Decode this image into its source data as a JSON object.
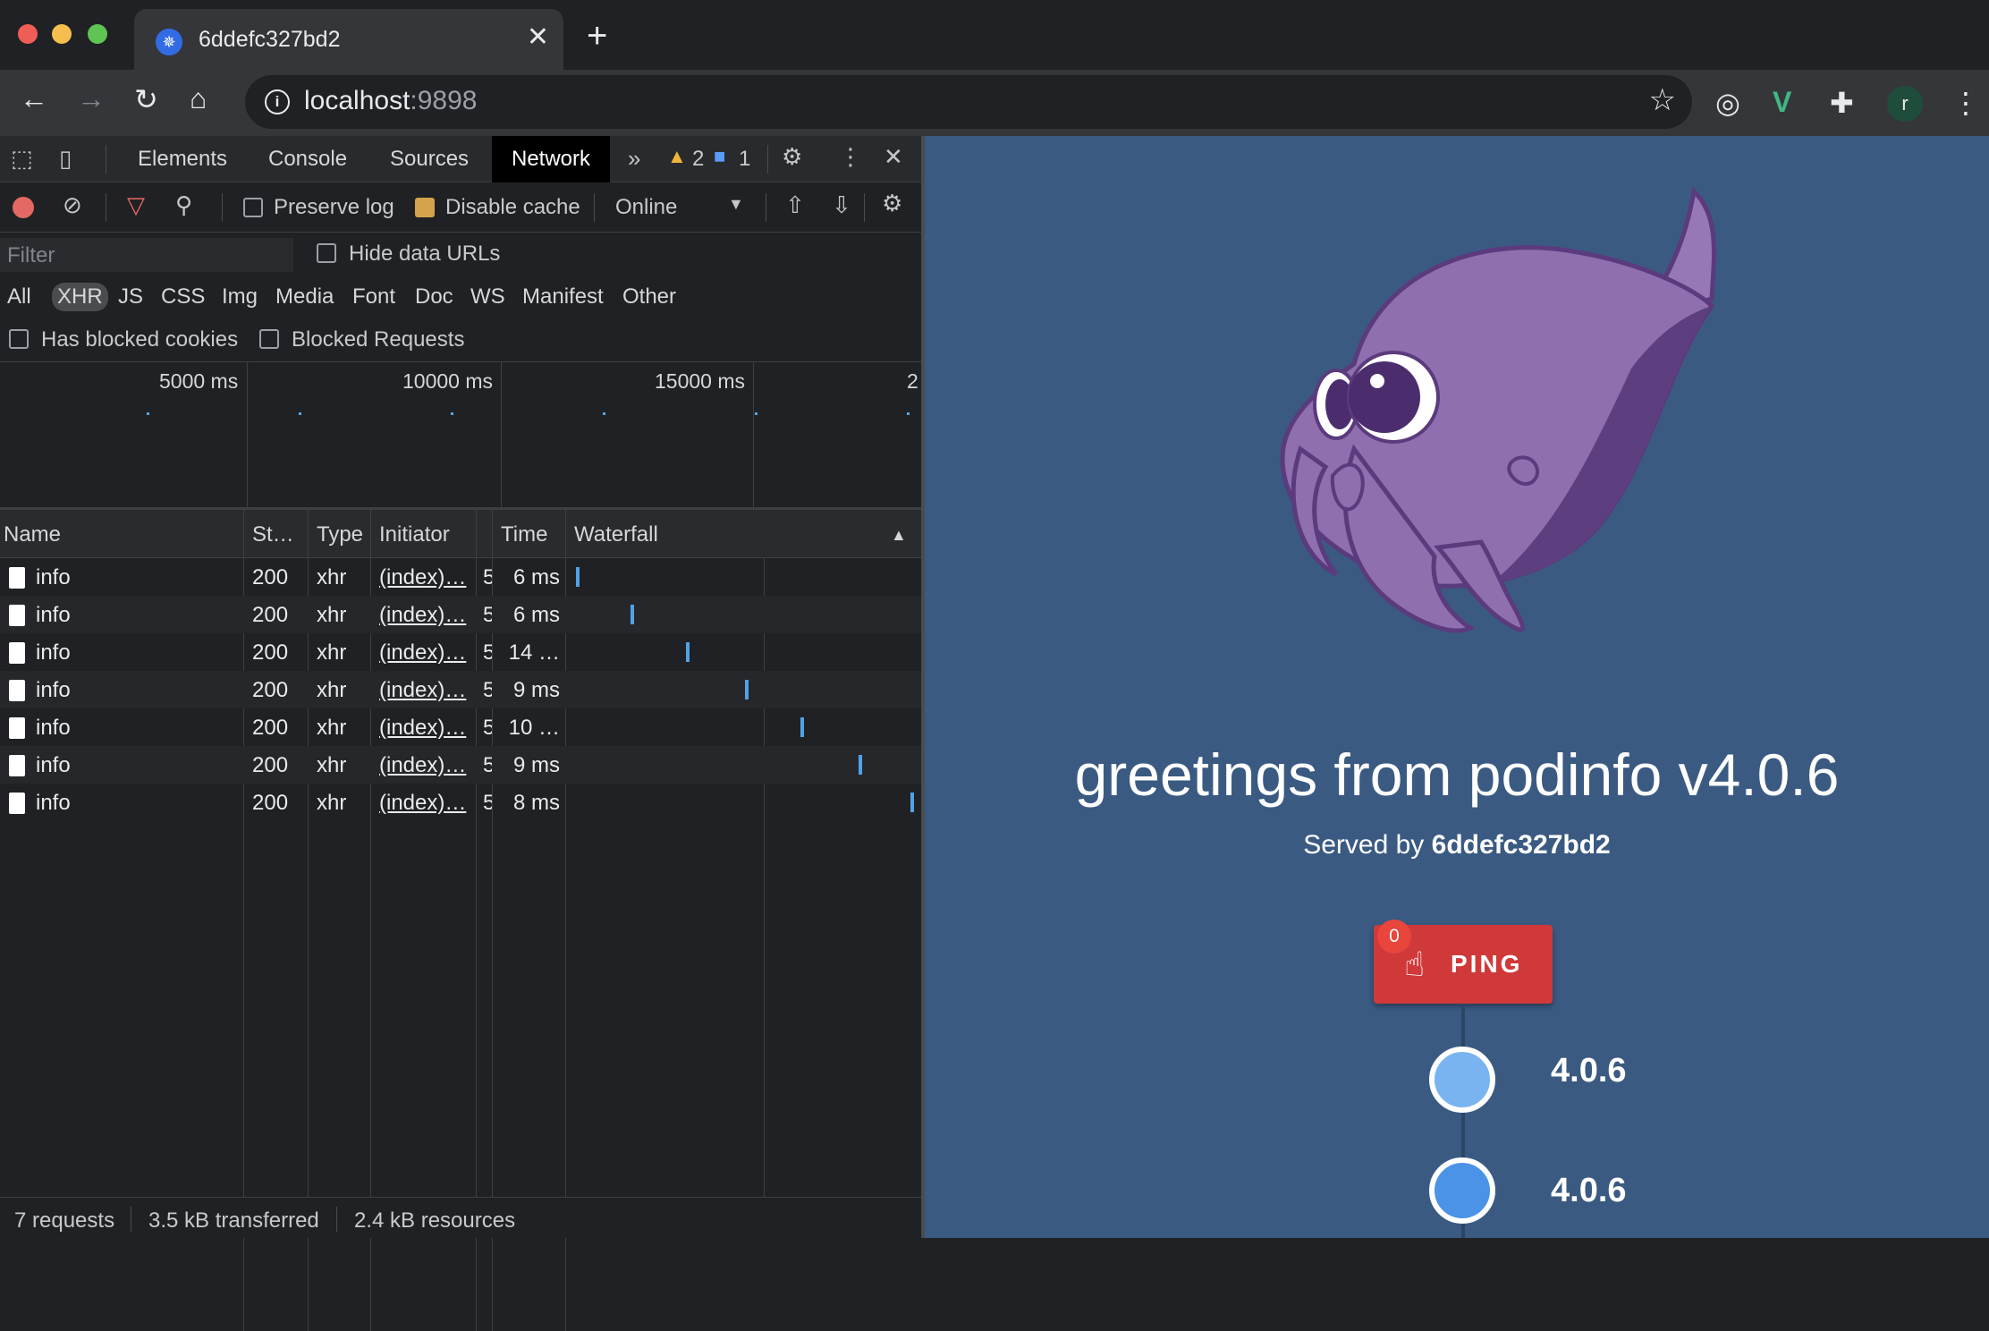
{
  "browser": {
    "tab_title": "6ddefc327bd2",
    "url_host": "localhost",
    "url_port": ":9898",
    "avatar_letter": "r"
  },
  "devtools": {
    "tabs": [
      "Elements",
      "Console",
      "Sources",
      "Network"
    ],
    "active_tab": "Network",
    "warnings_count": "2",
    "messages_count": "1",
    "preserve_log": "Preserve log",
    "disable_cache": "Disable cache",
    "throttle": "Online",
    "filter_placeholder": "Filter",
    "hide_data_urls": "Hide data URLs",
    "type_filters": [
      "All",
      "XHR",
      "JS",
      "CSS",
      "Img",
      "Media",
      "Font",
      "Doc",
      "WS",
      "Manifest",
      "Other"
    ],
    "active_type": "XHR",
    "has_blocked_cookies": "Has blocked cookies",
    "blocked_requests": "Blocked Requests",
    "overview_labels": [
      "5000 ms",
      "10000 ms",
      "15000 ms",
      "2"
    ],
    "columns": [
      "Name",
      "St…",
      "Type",
      "Initiator",
      "Time",
      "Waterfall"
    ],
    "rows": [
      {
        "name": "info",
        "status": "200",
        "type": "xhr",
        "initiator": "(index)…",
        "size": "5",
        "time": "6 ms",
        "wf": 0.02
      },
      {
        "name": "info",
        "status": "200",
        "type": "xhr",
        "initiator": "(index)…",
        "size": "5",
        "time": "6 ms",
        "wf": 0.18
      },
      {
        "name": "info",
        "status": "200",
        "type": "xhr",
        "initiator": "(index)…",
        "size": "5",
        "time": "14 …",
        "wf": 0.34
      },
      {
        "name": "info",
        "status": "200",
        "type": "xhr",
        "initiator": "(index)…",
        "size": "5",
        "time": "9 ms",
        "wf": 0.51
      },
      {
        "name": "info",
        "status": "200",
        "type": "xhr",
        "initiator": "(index)…",
        "size": "5",
        "time": "10 …",
        "wf": 0.67
      },
      {
        "name": "info",
        "status": "200",
        "type": "xhr",
        "initiator": "(index)…",
        "size": "5",
        "time": "9 ms",
        "wf": 0.84
      },
      {
        "name": "info",
        "status": "200",
        "type": "xhr",
        "initiator": "(index)…",
        "size": "5",
        "time": "8 ms",
        "wf": 0.99
      }
    ],
    "summary": {
      "requests": "7 requests",
      "transferred": "3.5 kB transferred",
      "resources": "2.4 kB resources"
    }
  },
  "page": {
    "heading": "greetings from podinfo v4.0.6",
    "served_prefix": "Served by ",
    "served_host": "6ddefc327bd2",
    "ping_label": "PING",
    "ping_count": "0",
    "timeline": [
      {
        "version": "4.0.6",
        "color": "#7ab4f0"
      },
      {
        "version": "4.0.6",
        "color": "#4a93e6"
      }
    ],
    "colors": {
      "background": "#3a5a82",
      "ping": "#d0393a",
      "mascot": "#8f6fae"
    }
  }
}
